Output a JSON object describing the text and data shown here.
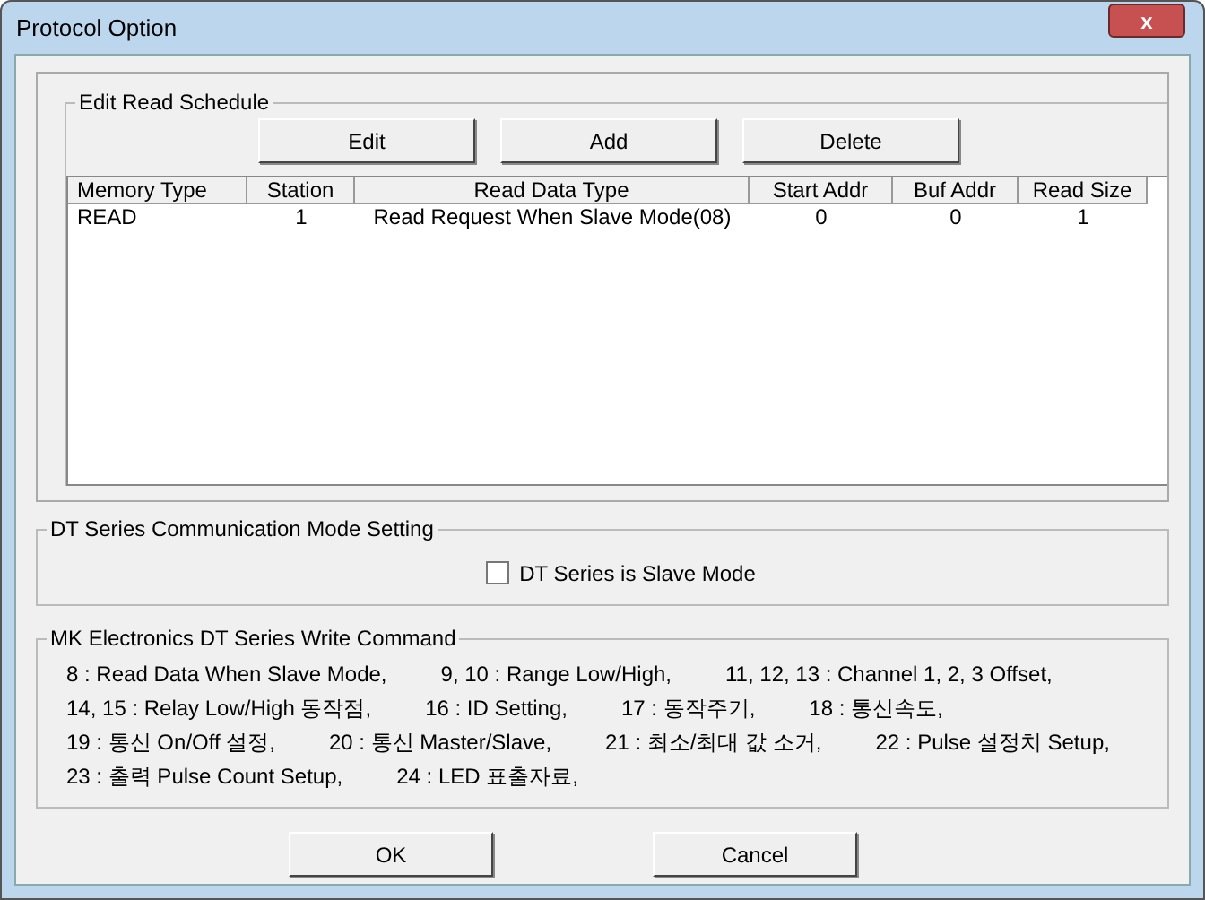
{
  "window": {
    "title": "Protocol Option",
    "close": "x"
  },
  "read_schedule": {
    "title": "Edit Read Schedule",
    "buttons": [
      "Edit",
      "Add",
      "Delete"
    ],
    "columns": [
      "Memory Type",
      "Station",
      "Read Data Type",
      "Start Addr",
      "Buf Addr",
      "Read Size"
    ],
    "rows": [
      [
        "READ",
        "1",
        "Read Request When Slave Mode(08)",
        "0",
        "0",
        "1"
      ]
    ]
  },
  "mode_setting": {
    "title": "DT Series Communication Mode Setting",
    "checkbox": {
      "label": "DT Series is Slave Mode",
      "checked": false
    }
  },
  "write_command": {
    "title": "MK Electronics DT Series Write Command",
    "lines": [
      [
        "8 : Read Data When Slave Mode,",
        "9, 10 : Range Low/High,",
        "11, 12, 13 : Channel 1, 2, 3 Offset,"
      ],
      [
        "14, 15 : Relay Low/High 동작점,",
        "16 : ID Setting,",
        "17 : 동작주기,",
        "18 : 통신속도,"
      ],
      [
        "19 : 통신 On/Off 설정,",
        "20 : 통신 Master/Slave,",
        "21 : 최소/최대 값 소거,",
        "22 : Pulse 설정치 Setup,"
      ],
      [
        "23 : 출력 Pulse Count Setup,",
        "24 : LED 표출자료,"
      ]
    ]
  },
  "buttons": [
    "OK",
    "Cancel"
  ]
}
